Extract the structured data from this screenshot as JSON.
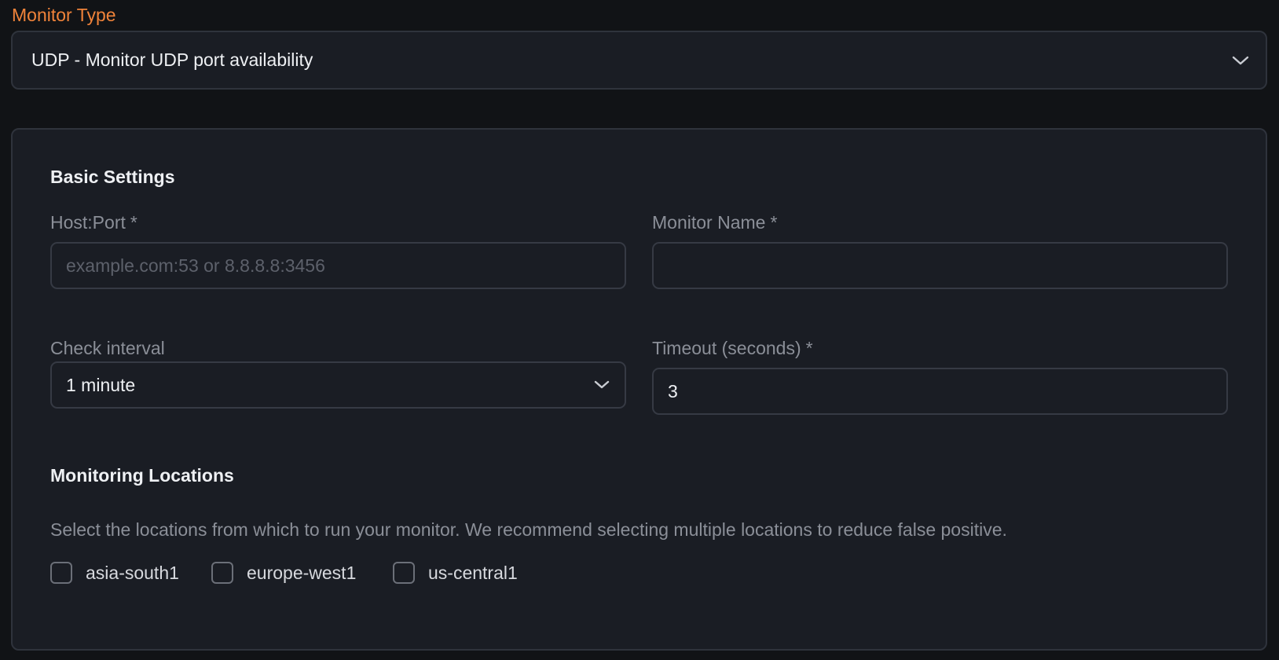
{
  "monitor_type": {
    "label": "Monitor Type",
    "selected": "UDP - Monitor UDP port availability"
  },
  "basic_settings": {
    "title": "Basic Settings",
    "host_port": {
      "label": "Host:Port",
      "required_mark": "*",
      "placeholder": "example.com:53  or 8.8.8.8:3456",
      "value": ""
    },
    "monitor_name": {
      "label": "Monitor Name",
      "required_mark": "*",
      "value": ""
    },
    "check_interval": {
      "label": "Check interval",
      "selected": "1 minute"
    },
    "timeout": {
      "label": "Timeout (seconds)",
      "required_mark": "*",
      "value": "3"
    }
  },
  "monitoring_locations": {
    "title": "Monitoring Locations",
    "description": "Select the locations from which to run your monitor. We recommend selecting multiple locations to reduce false positive.",
    "options": [
      {
        "label": "asia-south1",
        "checked": false
      },
      {
        "label": "europe-west1",
        "checked": false
      },
      {
        "label": "us-central1",
        "checked": false
      }
    ]
  },
  "colors": {
    "accent": "#f0833a",
    "background": "#111316",
    "card": "#1a1d24",
    "border": "#2f333c",
    "muted_text": "#8b8f98"
  },
  "icons": {
    "dropdown": "chevron-down-icon",
    "checkbox": "checkbox-unchecked-icon"
  }
}
